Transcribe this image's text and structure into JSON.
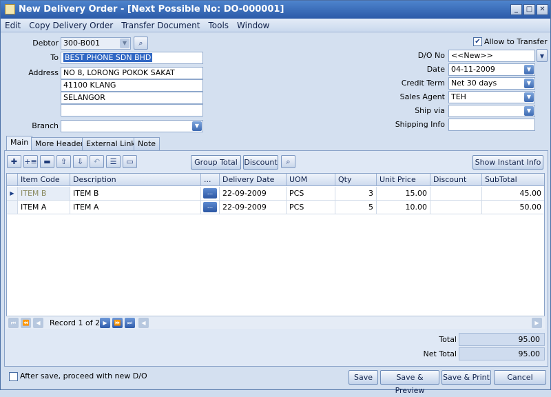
{
  "window": {
    "title": "New Delivery Order - [Next Possible No: DO-000001]"
  },
  "menu": [
    "Edit",
    "Copy Delivery Order",
    "Transfer Document",
    "Tools",
    "Window"
  ],
  "form": {
    "debtor_label": "Debtor",
    "debtor_value": "300-B001",
    "to_label": "To",
    "to_value": "BEST PHONE SDN BHD",
    "address_label": "Address",
    "address_lines": [
      "NO 8, LORONG POKOK SAKAT",
      "41100 KLANG",
      "SELANGOR",
      ""
    ],
    "branch_label": "Branch",
    "branch_value": "",
    "allow_transfer_label": "Allow to Transfer",
    "allow_transfer_checked": true,
    "do_no_label": "D/O No",
    "do_no_value": "<<New>>",
    "date_label": "Date",
    "date_value": "04-11-2009",
    "credit_term_label": "Credit Term",
    "credit_term_value": "Net 30 days",
    "sales_agent_label": "Sales Agent",
    "sales_agent_value": "TEH",
    "ship_via_label": "Ship via",
    "ship_via_value": "",
    "shipping_info_label": "Shipping Info",
    "shipping_info_value": ""
  },
  "tabs": [
    "Main",
    "More Header",
    "External Link",
    "Note"
  ],
  "toolbar": {
    "group_total": "Group Total",
    "discount": "Discount",
    "show_instant_info": "Show Instant Info"
  },
  "grid": {
    "columns": [
      "Item Code",
      "Description",
      "...",
      "Delivery Date",
      "UOM",
      "Qty",
      "Unit Price",
      "Discount",
      "SubTotal"
    ],
    "rows": [
      {
        "item_code": "ITEM B",
        "description": "ITEM B",
        "delivery_date": "22-09-2009",
        "uom": "PCS",
        "qty": "3",
        "unit_price": "15.00",
        "discount": "",
        "subtotal": "45.00"
      },
      {
        "item_code": "ITEM A",
        "description": "ITEM A",
        "delivery_date": "22-09-2009",
        "uom": "PCS",
        "qty": "5",
        "unit_price": "10.00",
        "discount": "",
        "subtotal": "50.00"
      }
    ],
    "ellipsis": "..."
  },
  "navigator": {
    "record_text": "Record 1 of 2"
  },
  "totals": {
    "total_label": "Total",
    "total_value": "95.00",
    "net_total_label": "Net Total",
    "net_total_value": "95.00"
  },
  "footer": {
    "after_save_label": "After save, proceed with new D/O",
    "save": "Save",
    "save_preview": "Save & Preview",
    "save_print": "Save & Print",
    "cancel": "Cancel"
  },
  "icons": {
    "app": "document-icon",
    "lookup": "magnifier-icon"
  },
  "colors": {
    "titlebar": "#2b5aa8",
    "selection": "#3168c4"
  }
}
